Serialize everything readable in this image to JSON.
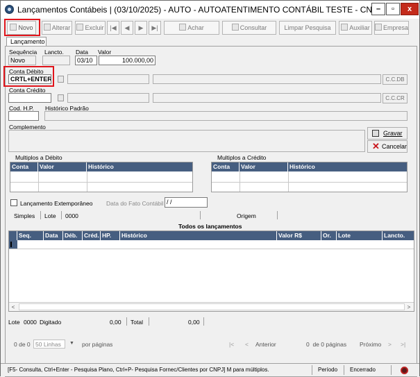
{
  "window": {
    "title": "Lançamentos Contábeis | (03/10/2025) - AUTO - AUTOATENTIMENTO CONTÁBIL TESTE  - CN...",
    "minimize": "–",
    "maximize": "▫",
    "close": "x"
  },
  "toolbar": {
    "novo": "Novo",
    "alterar": "Alterar",
    "excluir": "Excluir",
    "first": "|◀",
    "prev": "◀",
    "next": "▶",
    "last": "▶|",
    "achar": "Achar",
    "consultar": "Consultar",
    "limpar": "Limpar Pesquisa",
    "auxiliar": "Auxiliar",
    "empresa": "Empresa"
  },
  "tabs": {
    "lancamento": "Lançamento"
  },
  "form": {
    "sequencia_label": "Sequência",
    "sequencia_value": "Novo",
    "lancto_label": "Lancto.",
    "data_label": "Data",
    "data_value": "03/10",
    "valor_label": "Valor",
    "valor_value": "100.000,00",
    "conta_debito_label": "Conta Débito",
    "conta_debito_value": "CRTL+ENTER",
    "ccdb_button": "C.C.DB",
    "conta_credito_label": "Conta Crédito",
    "cccr_button": "C.C.CR",
    "cod_hp_label": "Cod. H.P.",
    "historico_padrao_label": "Histórico Padrão",
    "complemento_label": "Complemento",
    "gravar": "Gravar",
    "cancelar": "Cancelar"
  },
  "multiplos_debito": {
    "title": "Multiplos a Débito",
    "columns": [
      "Conta",
      "Valor",
      "Histórico"
    ]
  },
  "multiplos_credito": {
    "title": "Multiplos a Crédito",
    "columns": [
      "Conta",
      "Valor",
      "Histórico"
    ]
  },
  "extemporaneo": {
    "checkbox_label": "Lançamento Extemporâneo",
    "data_fato_label": "Data do Fato Contábil",
    "data_fato_value": " / /"
  },
  "info_bar": {
    "simples": "Simples",
    "lote_label": "Lote",
    "lote_value": "0000",
    "origem": "Origem"
  },
  "todos": {
    "title": "Todos os lançamentos",
    "columns": [
      "Seq.",
      "Data",
      "Déb.",
      "Créd.",
      "HP.",
      "Histórico",
      "Valor R$",
      "Or.",
      "Lote",
      "Lancto."
    ]
  },
  "summary": {
    "lote_label": "Lote",
    "lote_value": "0000",
    "digitado": "Digitado",
    "digitado_value": "0,00",
    "total": "Total",
    "total_value": "0,00"
  },
  "pagination": {
    "info_prefix": "0 de 0",
    "per_page_select": "50 Linhas",
    "per_page_suffix": "por páginas",
    "first": "|<",
    "prev": "<",
    "anterior": "Anterior",
    "page_info": "0  de 0 páginas",
    "proximo": "Próximo",
    "next": ">",
    "last": ">|"
  },
  "statusbar": {
    "hint": "[F5- Consulta, Ctrl+Enter - Pesquisa Plano, Ctrl+P- Pesquisa Fornec/Clientes por CNPJ] M para múltiplos.",
    "periodo": "Período",
    "encerrado": "Encerrado"
  },
  "colors": {
    "grid_header": "#465e80",
    "highlight": "#e0141b",
    "close": "#c42b1c"
  }
}
